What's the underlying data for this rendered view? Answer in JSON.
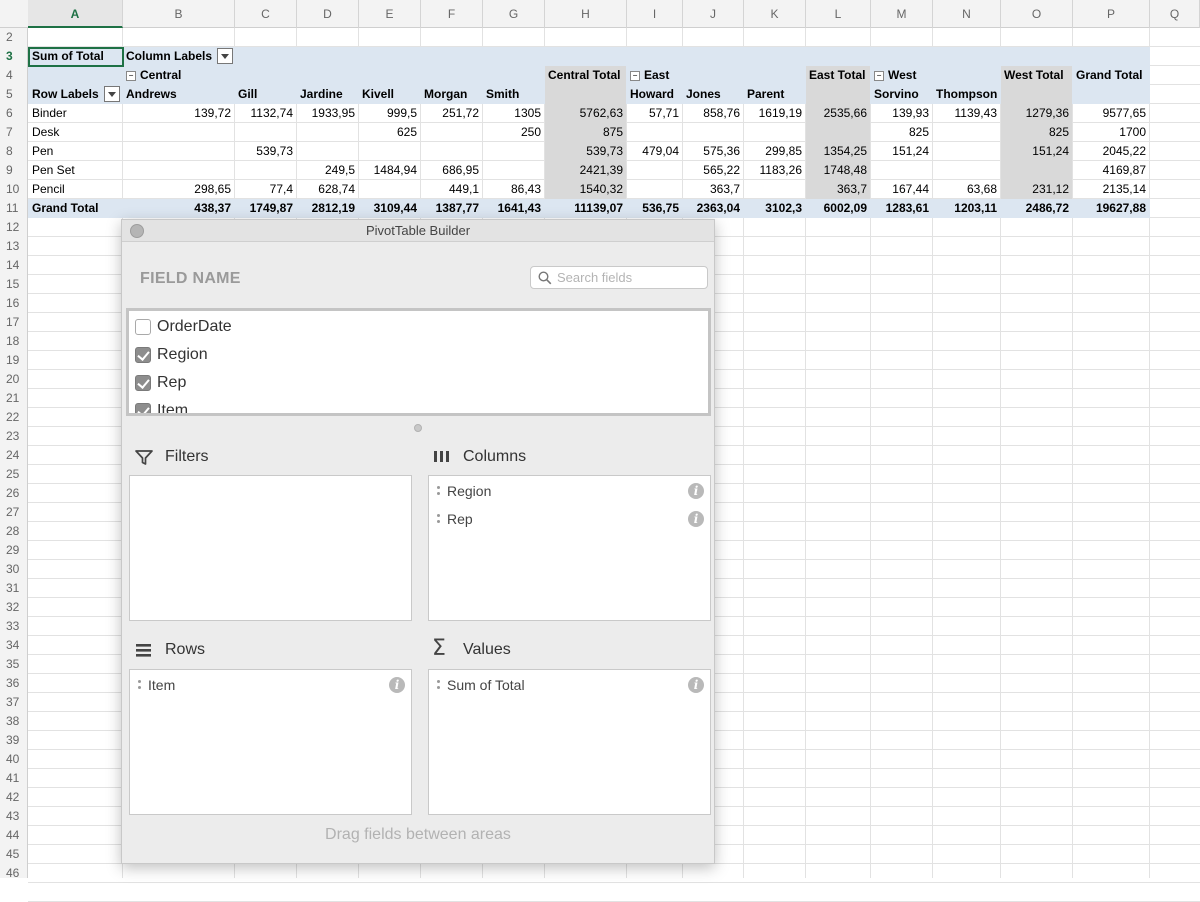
{
  "columns": [
    "A",
    "B",
    "C",
    "D",
    "E",
    "F",
    "G",
    "H",
    "I",
    "J",
    "K",
    "L",
    "M",
    "N",
    "O",
    "P",
    "Q"
  ],
  "selected_column": "A",
  "row_numbers": [
    "2",
    "3",
    "4",
    "5",
    "6",
    "7",
    "8",
    "9",
    "10",
    "11",
    "12",
    "13",
    "14",
    "15",
    "16",
    "17",
    "18",
    "19",
    "20",
    "21",
    "22",
    "23",
    "24",
    "25",
    "26",
    "27",
    "28",
    "29",
    "30",
    "31",
    "32",
    "33",
    "34",
    "35",
    "36",
    "37",
    "38",
    "39",
    "40",
    "41",
    "42",
    "43",
    "44",
    "45",
    "46"
  ],
  "selected_row": "3",
  "pivot": {
    "corner_label": "Sum of Total",
    "column_labels": "Column Labels",
    "row_labels": "Row Labels",
    "regions": [
      {
        "name": "Central",
        "total_label": "Central Total"
      },
      {
        "name": "East",
        "total_label": "East Total"
      },
      {
        "name": "West",
        "total_label": "West Total"
      }
    ],
    "grand_total_label": "Grand Total",
    "reps": [
      "Andrews",
      "Gill",
      "Jardine",
      "Kivell",
      "Morgan",
      "Smith",
      "",
      "Howard",
      "Jones",
      "Parent",
      "",
      "Sorvino",
      "Thompson",
      "",
      ""
    ],
    "rows": [
      {
        "label": "Binder",
        "values": [
          "139,72",
          "1132,74",
          "1933,95",
          "999,5",
          "251,72",
          "1305",
          "5762,63",
          "57,71",
          "858,76",
          "1619,19",
          "2535,66",
          "139,93",
          "1139,43",
          "1279,36",
          "9577,65"
        ]
      },
      {
        "label": "Desk",
        "values": [
          "",
          "",
          "",
          "625",
          "",
          "250",
          "875",
          "",
          "",
          "",
          "",
          "825",
          "",
          "825",
          "1700"
        ]
      },
      {
        "label": "Pen",
        "values": [
          "",
          "539,73",
          "",
          "",
          "",
          "",
          "539,73",
          "479,04",
          "575,36",
          "299,85",
          "1354,25",
          "151,24",
          "",
          "151,24",
          "2045,22"
        ]
      },
      {
        "label": "Pen Set",
        "values": [
          "",
          "",
          "249,5",
          "1484,94",
          "686,95",
          "",
          "2421,39",
          "",
          "565,22",
          "1183,26",
          "1748,48",
          "",
          "",
          "",
          "4169,87"
        ]
      },
      {
        "label": "Pencil",
        "values": [
          "298,65",
          "77,4",
          "628,74",
          "",
          "449,1",
          "86,43",
          "1540,32",
          "",
          "363,7",
          "",
          "363,7",
          "167,44",
          "63,68",
          "231,12",
          "2135,14"
        ]
      }
    ],
    "grand_total": {
      "label": "Grand Total",
      "values": [
        "438,37",
        "1749,87",
        "2812,19",
        "3109,44",
        "1387,77",
        "1641,43",
        "11139,07",
        "536,75",
        "2363,04",
        "3102,3",
        "6002,09",
        "1283,61",
        "1203,11",
        "2486,72",
        "19627,88"
      ]
    }
  },
  "builder": {
    "title": "PivotTable Builder",
    "field_name_label": "FIELD NAME",
    "search_placeholder": "Search fields",
    "fields": [
      {
        "name": "OrderDate",
        "checked": false
      },
      {
        "name": "Region",
        "checked": true
      },
      {
        "name": "Rep",
        "checked": true
      },
      {
        "name": "Item",
        "checked": true
      }
    ],
    "areas": {
      "filters": {
        "label": "Filters",
        "icon": "funnel-icon",
        "items": []
      },
      "columns": {
        "label": "Columns",
        "icon": "columns-icon",
        "items": [
          "Region",
          "Rep"
        ]
      },
      "rows": {
        "label": "Rows",
        "icon": "rows-icon",
        "items": [
          "Item"
        ]
      },
      "values": {
        "label": "Values",
        "icon": "sigma-icon",
        "items": [
          "Sum of Total"
        ]
      }
    },
    "info_glyph": "i",
    "sigma_glyph": "Σ",
    "footer": "Drag fields between areas"
  },
  "colors": {
    "accent": "#1e7145",
    "header_band": "#dce6f1",
    "subtotal_band": "#d9d9d9"
  }
}
